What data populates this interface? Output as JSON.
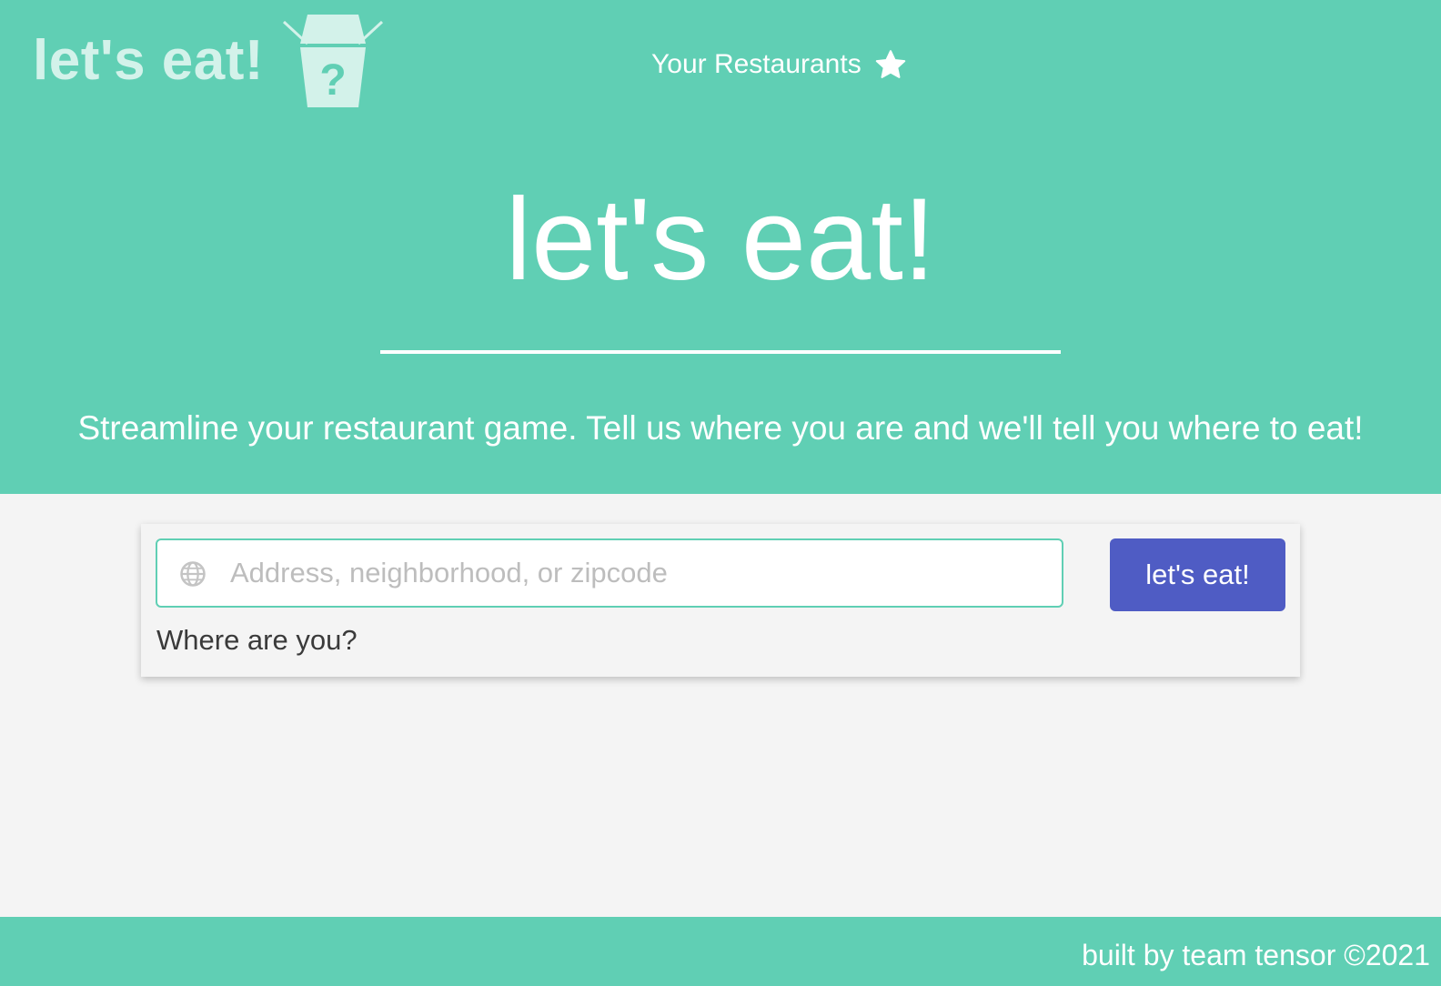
{
  "brand": {
    "name": "let's eat!",
    "logo_icon": "takeout-box-question-icon",
    "logo_symbol": "?"
  },
  "nav": {
    "favorites_label": "Your Restaurants",
    "favorites_icon": "star-icon"
  },
  "hero": {
    "title": "let's eat!",
    "tagline": "Streamline your restaurant game. Tell us where you are and we'll tell you where to eat!"
  },
  "search": {
    "icon": "globe-icon",
    "value": "",
    "placeholder": "Address, neighborhood, or zipcode",
    "label": "Where are you?",
    "submit_label": "let's eat!"
  },
  "footer": {
    "text": "built by team tensor ©2021"
  },
  "colors": {
    "primary": "#60cfb4",
    "brand_text": "#d3f2ea",
    "button": "#4f5cc4",
    "background": "#f4f4f4"
  }
}
